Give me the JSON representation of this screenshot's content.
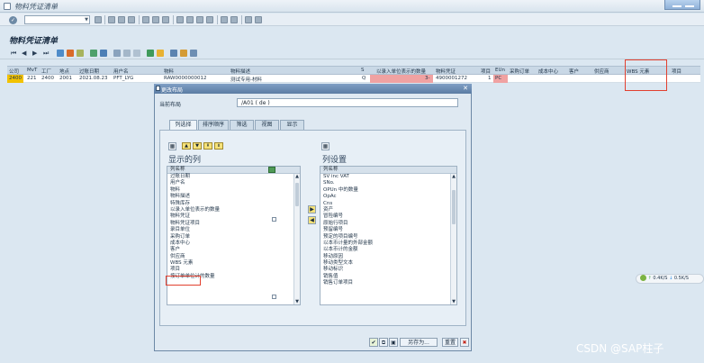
{
  "window": {
    "title": "物料凭证清单"
  },
  "page": {
    "heading": "物料凭证清单"
  },
  "grid": {
    "columns": [
      {
        "label": "公司"
      },
      {
        "label": "MvT"
      },
      {
        "label": "工厂"
      },
      {
        "label": "地点"
      },
      {
        "label": "过账日期"
      },
      {
        "label": "用户名"
      },
      {
        "label": "物料"
      },
      {
        "label": "物料描述"
      },
      {
        "label": "S"
      },
      {
        "label": "以录入单位表示的数量"
      },
      {
        "label": "物料凭证"
      },
      {
        "label": "项目"
      },
      {
        "label": "EUn"
      },
      {
        "label": "采购订单"
      },
      {
        "label": "成本中心"
      },
      {
        "label": "客户"
      },
      {
        "label": "供应商"
      },
      {
        "label": "WBS 元素"
      },
      {
        "label": "项目"
      }
    ],
    "row": {
      "company": "2400",
      "mvt": "221",
      "plant": "2400",
      "sloc": "2001",
      "date": "2021.08.23",
      "user": "PFT_LYG",
      "material": "RAW0000000012",
      "desc": "测试专用-材料",
      "s": "Q",
      "qty": "3-",
      "doc": "4900001272",
      "item": "1",
      "eun": "PC"
    }
  },
  "dialog": {
    "title": "更改布局",
    "current_layout_label": "当前布局",
    "current_layout_value": "/A01 ( de )",
    "tabs": [
      {
        "label": "列选择"
      },
      {
        "label": "排序顺序"
      },
      {
        "label": "筛选"
      },
      {
        "label": "视图"
      },
      {
        "label": "显示"
      }
    ],
    "left_list": {
      "title": "显示的列",
      "header": "列名称",
      "items": [
        "过账日期",
        "用户名",
        "物料",
        "物料描述",
        "特殊库存",
        "以录入单位表示的数量",
        "物料凭证",
        "物料凭证项目",
        "录目单位",
        "采购订单",
        "成本中心",
        "客户",
        "供应商",
        "WBS 元素",
        "项目",
        "按订单单位计的数量"
      ]
    },
    "right_list": {
      "title": "列设置",
      "header": "列名称",
      "items": [
        "SV inc VAT",
        "SNo.",
        "OPUn 中的数量",
        "OpAc",
        "Cns",
        "资产",
        "冒险编号",
        "原始行项目",
        "预留编号",
        "预定的项目编号",
        "以本币计量的外部金额",
        "以本币计的金额",
        "移动原因",
        "移动类型文本",
        "移动标识",
        "销售值",
        "销售订单项目"
      ]
    },
    "buttons": {
      "save_as": "另存为...",
      "reset": "重置"
    }
  },
  "status_widget": {
    "up": "0.4K/S",
    "down": "0.5K/S"
  },
  "watermark": "CSDN @SAP柱子",
  "colors": {
    "highlight": "#f0a2a2",
    "selection": "#f2c200",
    "callout": "#e2402f",
    "titlebar": "#5b7ca3"
  },
  "icons": {
    "app": "app-icon",
    "ok": "ok-icon",
    "nav": [
      "first-icon",
      "prev-icon",
      "next-icon",
      "last-icon"
    ],
    "list_toolbar": [
      "detail-icon",
      "filter-icon",
      "sum-icon",
      "sort-icon",
      "layout-icon",
      "export-icon"
    ]
  }
}
